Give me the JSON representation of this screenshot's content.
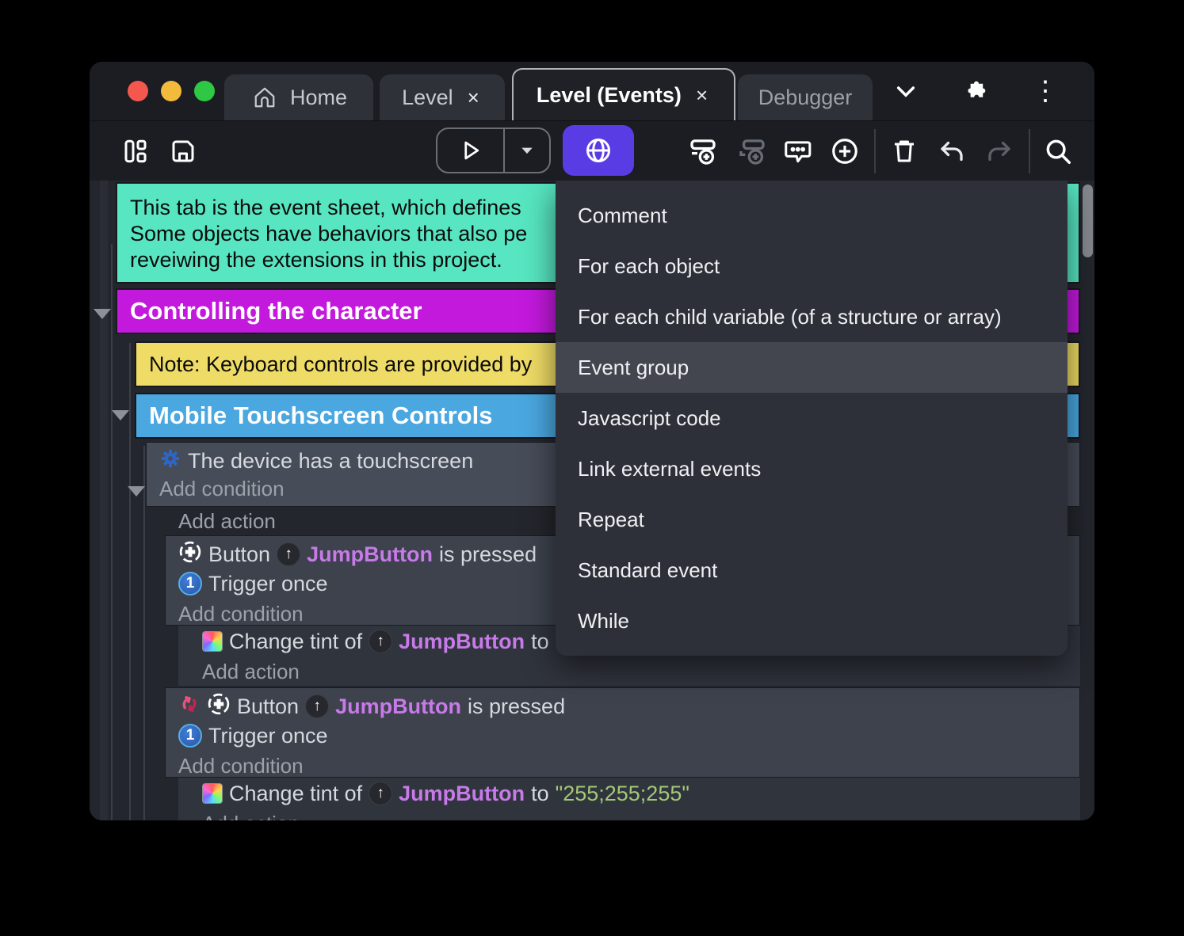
{
  "tabs": {
    "home": {
      "label": "Home"
    },
    "level": {
      "label": "Level",
      "close": "×"
    },
    "events": {
      "label": "Level (Events)",
      "close": "×"
    },
    "debugger": {
      "label": "Debugger"
    }
  },
  "toolbar": {
    "icons": [
      "project-manager",
      "save",
      "play",
      "play-options",
      "preview-network",
      "add-event",
      "add-subevent",
      "add-comment",
      "add-other",
      "delete",
      "undo",
      "redo",
      "search"
    ]
  },
  "event_sheet": {
    "top_comment": {
      "line1": "This tab is the event sheet, which defines",
      "line2": "Some objects have behaviors that also pe",
      "line3": "reveiwing the extensions in this project."
    },
    "group_controlling": "Controlling the character",
    "note_keyboard": "Note: Keyboard controls are provided by",
    "group_mobile": "Mobile Touchscreen Controls",
    "labels": {
      "add_condition": "Add condition",
      "add_action": "Add action"
    },
    "event1": {
      "condition": "The device has a touchscreen"
    },
    "event2": {
      "prefix": "Button",
      "object": "JumpButton",
      "suffix": "is pressed",
      "trigger": "Trigger once"
    },
    "tint1": {
      "prefix": "Change tint of",
      "object": "JumpButton",
      "to": "to"
    },
    "event3": {
      "prefix": "Button",
      "object": "JumpButton",
      "suffix": "is pressed",
      "trigger": "Trigger once"
    },
    "tint2": {
      "prefix": "Change tint of",
      "object": "JumpButton",
      "to": "to",
      "value": "\"255;255;255\""
    }
  },
  "context_menu": {
    "items": [
      "Comment",
      "For each object",
      "For each child variable (of a structure or array)",
      "Event group",
      "Javascript code",
      "Link external events",
      "Repeat",
      "Standard event",
      "While"
    ],
    "highlighted": "Event group"
  },
  "colors": {
    "accent_purple": "#5a3ce4",
    "comment_teal": "#57e6c1",
    "group_magenta": "#c319dd",
    "note_yellow": "#efdc66",
    "group_blue": "#4aa7e0",
    "object_name": "#c77ae8",
    "string_green": "#a3c977"
  }
}
